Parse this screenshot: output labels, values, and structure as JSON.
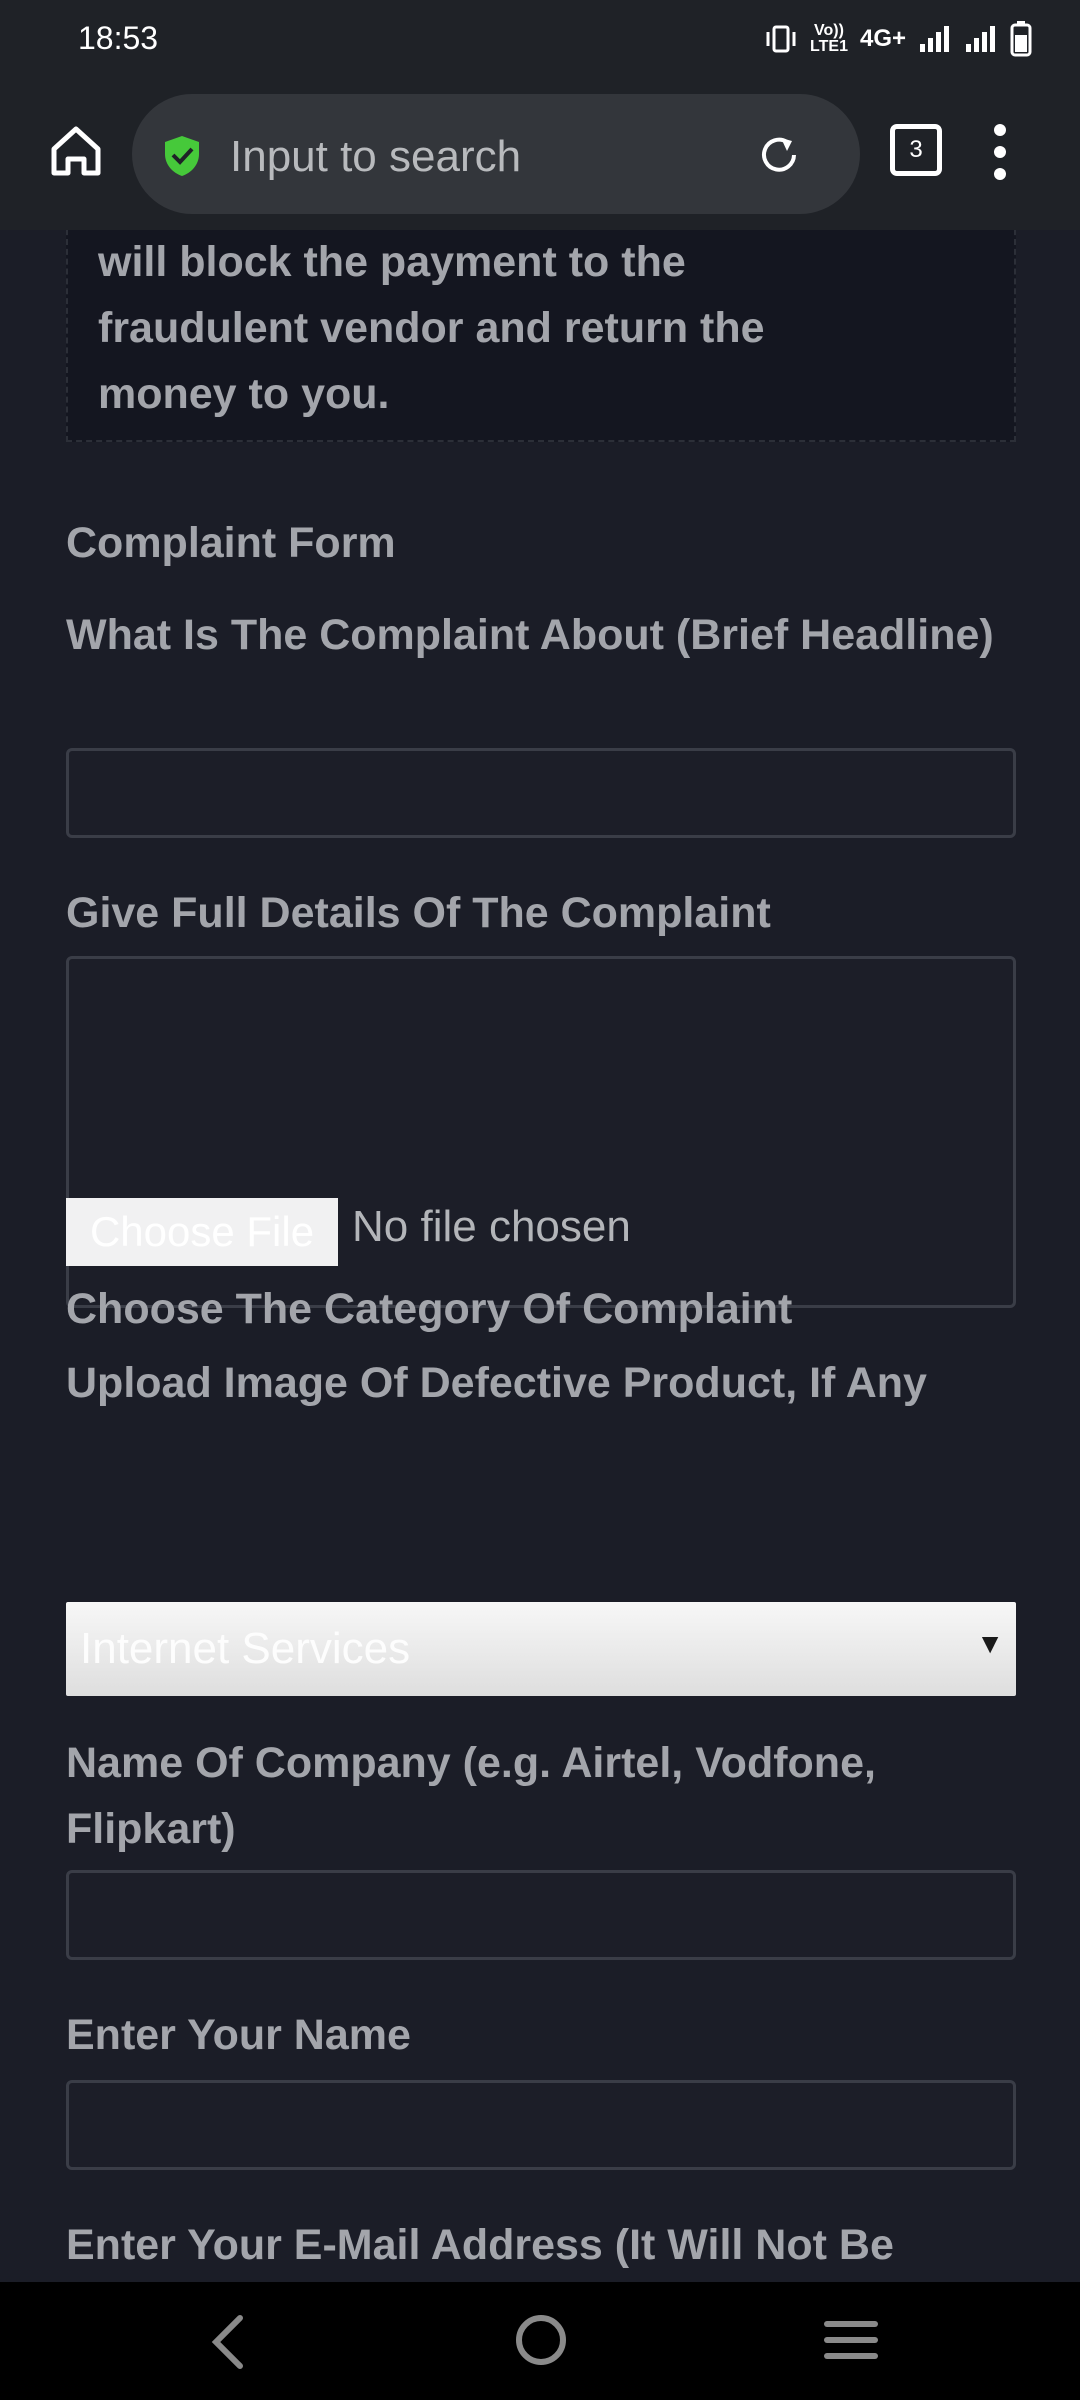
{
  "status_bar": {
    "time": "18:53",
    "network": "4G+",
    "volte_line1": "Vo))",
    "volte_line2": "LTE1"
  },
  "browser": {
    "search_placeholder": "Input to search",
    "tab_count": "3"
  },
  "notice": {
    "lines": [
      "will block the payment to the",
      "fraudulent vendor and return the",
      "money to you."
    ]
  },
  "form": {
    "title": "Complaint Form",
    "headline_label": "What Is The Complaint About (Brief Headline)",
    "details_label": "Give Full Details Of The Complaint",
    "upload_label": "Upload Image Of Defective Product, If Any",
    "choose_file_button": "Choose File",
    "no_file_text": "No file chosen",
    "category_label": "Choose The Category Of Complaint",
    "category_selected": "Internet Services",
    "company_label": "Name Of Company (e.g. Airtel, Vodfone, Flipkart)",
    "name_label": "Enter Your Name",
    "email_label": "Enter Your E-Mail Address (It Will Not Be"
  },
  "colors": {
    "page_background": "#1b1d27",
    "label_text": "#a3a5ab",
    "shield_green": "#46c93a",
    "toolbar": "#1f2227"
  }
}
